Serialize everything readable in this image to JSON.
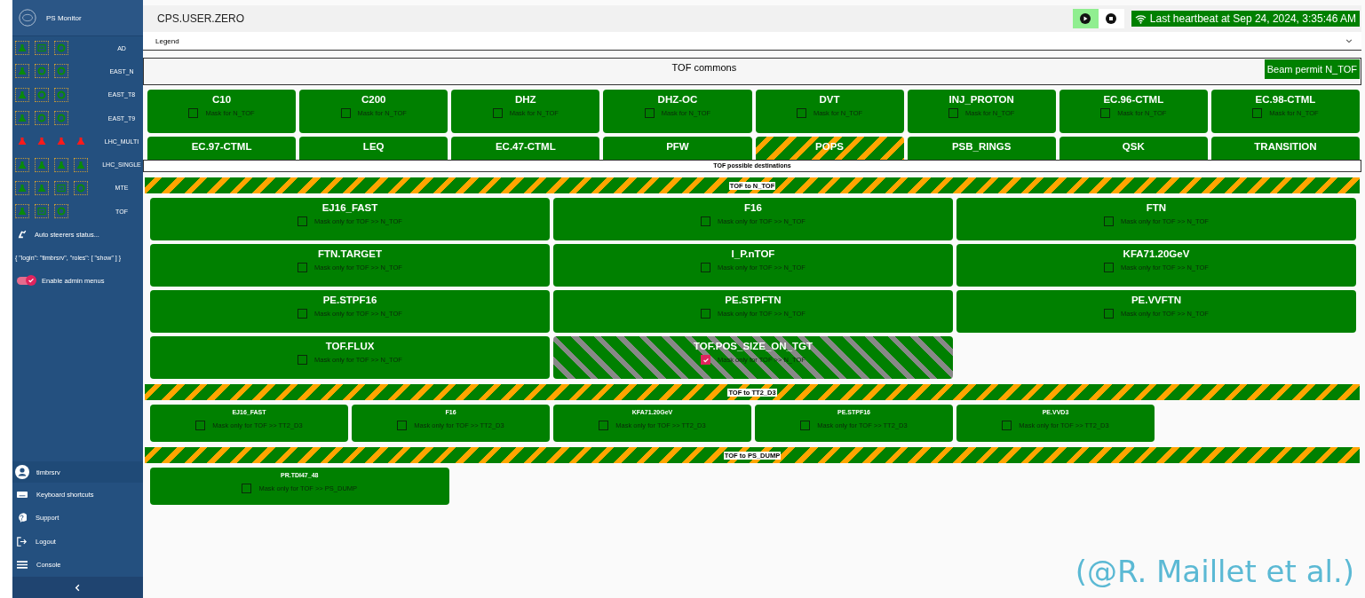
{
  "sidebar": {
    "app_title": "PS Monitor",
    "beams": [
      {
        "name": "AD",
        "icons": [
          {
            "kind": "flask",
            "alarm": false
          },
          {
            "kind": "door",
            "alarm": false
          },
          {
            "kind": "ring",
            "alarm": false
          }
        ]
      },
      {
        "name": "EAST_N",
        "icons": [
          {
            "kind": "flask",
            "alarm": false
          },
          {
            "kind": "ring",
            "alarm": false
          },
          {
            "kind": "ring",
            "alarm": false
          }
        ]
      },
      {
        "name": "EAST_T8",
        "icons": [
          {
            "kind": "flask",
            "alarm": false
          },
          {
            "kind": "ring",
            "alarm": false
          },
          {
            "kind": "ring",
            "alarm": false
          }
        ]
      },
      {
        "name": "EAST_T9",
        "icons": [
          {
            "kind": "flask",
            "alarm": false
          },
          {
            "kind": "ring",
            "alarm": false
          },
          {
            "kind": "ring",
            "alarm": false
          }
        ]
      },
      {
        "name": "LHC_MULTI",
        "icons": [
          {
            "kind": "flask",
            "alarm": true
          },
          {
            "kind": "flask",
            "alarm": true
          },
          {
            "kind": "flask",
            "alarm": true
          },
          {
            "kind": "flask",
            "alarm": true
          }
        ]
      },
      {
        "name": "LHC_SINGLE",
        "icons": [
          {
            "kind": "flask",
            "alarm": false
          },
          {
            "kind": "flask",
            "alarm": false
          },
          {
            "kind": "flask",
            "alarm": false
          },
          {
            "kind": "flask",
            "alarm": false
          }
        ]
      },
      {
        "name": "MTE",
        "icons": [
          {
            "kind": "flask",
            "alarm": false
          },
          {
            "kind": "flask",
            "alarm": false
          },
          {
            "kind": "door",
            "alarm": false
          },
          {
            "kind": "ring",
            "alarm": false
          }
        ]
      },
      {
        "name": "TOF",
        "icons": [
          {
            "kind": "flask",
            "alarm": false
          },
          {
            "kind": "door",
            "alarm": false
          },
          {
            "kind": "ring",
            "alarm": false
          }
        ]
      }
    ],
    "auto_steerers": "Auto steerers status...",
    "session_info": "{ \"login\": \"timbrsrv\", \"roles\": [ \"show\" ] }",
    "admin_toggle": {
      "label": "Enable admin menus",
      "on": true
    },
    "user": "timbrsrv",
    "menu": [
      {
        "kind": "keyboard",
        "label": "Keyboard shortcuts"
      },
      {
        "kind": "help",
        "label": "Support"
      },
      {
        "kind": "logout",
        "label": "Logout"
      },
      {
        "kind": "list",
        "label": "Console"
      }
    ]
  },
  "header": {
    "title": "CPS.USER.ZERO",
    "play_selected": true,
    "stop_selected": false,
    "heartbeat": "Last heartbeat at Sep 24, 2024, 3:35:46 AM"
  },
  "legend": {
    "label": "Legend",
    "expanded": false
  },
  "commons": {
    "title": "TOF commons",
    "beam_permit": "Beam permit N_TOF",
    "items": [
      {
        "name": "C10",
        "kind": "ok",
        "mask_label": "Mask for N_TOF",
        "checked": false
      },
      {
        "name": "C200",
        "kind": "ok",
        "mask_label": "Mask for N_TOF",
        "checked": false
      },
      {
        "name": "DHZ",
        "kind": "ok",
        "mask_label": "Mask for N_TOF",
        "checked": false
      },
      {
        "name": "DHZ-OC",
        "kind": "ok",
        "mask_label": "Mask for N_TOF",
        "checked": false
      },
      {
        "name": "DVT",
        "kind": "ok",
        "mask_label": "Mask for N_TOF",
        "checked": false
      },
      {
        "name": "INJ_PROTON",
        "kind": "ok",
        "mask_label": "Mask for N_TOF",
        "checked": false
      },
      {
        "name": "EC.96-CTML",
        "kind": "ok",
        "mask_label": "Mask for N_TOF",
        "checked": false
      },
      {
        "name": "EC.98-CTML",
        "kind": "ok",
        "mask_label": "Mask for N_TOF",
        "checked": false
      },
      {
        "name": "EC.97-CTML",
        "kind": "ok"
      },
      {
        "name": "LEQ",
        "kind": "ok"
      },
      {
        "name": "EC.47-CTML",
        "kind": "ok"
      },
      {
        "name": "PFW",
        "kind": "ok"
      },
      {
        "name": "POPS",
        "kind": "warning"
      },
      {
        "name": "PSB_RINGS",
        "kind": "ok"
      },
      {
        "name": "QSK",
        "kind": "ok"
      },
      {
        "name": "TRANSITION",
        "kind": "ok"
      }
    ]
  },
  "destinations_title": "TOF possible destinations",
  "destinations": [
    {
      "title": "TOF to N_TOF",
      "items": [
        {
          "name": "EJ16_FAST",
          "kind": "ok",
          "mask_label": "Mask only for TOF >> N_TOF",
          "checked": false
        },
        {
          "name": "F16",
          "kind": "ok",
          "mask_label": "Mask only for TOF >> N_TOF",
          "checked": false
        },
        {
          "name": "FTN",
          "kind": "ok",
          "mask_label": "Mask only for TOF >> N_TOF",
          "checked": false
        },
        {
          "name": "FTN.TARGET",
          "kind": "ok",
          "mask_label": "Mask only for TOF >> N_TOF",
          "checked": false
        },
        {
          "name": "I_P.nTOF",
          "kind": "ok",
          "mask_label": "Mask only for TOF >> N_TOF",
          "checked": false
        },
        {
          "name": "KFA71.20GeV",
          "kind": "ok",
          "mask_label": "Mask only for TOF >> N_TOF",
          "checked": false
        },
        {
          "name": "PE.STPF16",
          "kind": "ok",
          "mask_label": "Mask only for TOF >> N_TOF",
          "checked": false
        },
        {
          "name": "PE.STPFTN",
          "kind": "ok",
          "mask_label": "Mask only for TOF >> N_TOF",
          "checked": false
        },
        {
          "name": "PE.VVFTN",
          "kind": "ok",
          "mask_label": "Mask only for TOF >> N_TOF",
          "checked": false
        },
        {
          "name": "TOF.FLUX",
          "kind": "ok",
          "mask_label": "Mask only for TOF >> N_TOF",
          "checked": false
        },
        {
          "name": "TOF.POS_SIZE_ON_TGT",
          "kind": "masked",
          "mask_label": "Mask only for TOF >> N_TOF",
          "checked": true
        }
      ]
    },
    {
      "title": "TOF to TT2_D3",
      "items": [
        {
          "name": "EJ16_FAST",
          "kind": "ok",
          "mask_label": "Mask only for TOF >> TT2_D3",
          "checked": false
        },
        {
          "name": "F16",
          "kind": "ok",
          "mask_label": "Mask only for TOF >> TT2_D3",
          "checked": false
        },
        {
          "name": "KFA71.20GeV",
          "kind": "ok",
          "mask_label": "Mask only for TOF >> TT2_D3",
          "checked": false
        },
        {
          "name": "PE.STPF16",
          "kind": "ok",
          "mask_label": "Mask only for TOF >> TT2_D3",
          "checked": false
        },
        {
          "name": "PE.VVD3",
          "kind": "ok",
          "mask_label": "Mask only for TOF >> TT2_D3",
          "checked": false
        }
      ]
    },
    {
      "title": "TOF to PS_DUMP",
      "items": [
        {
          "name": "PR.TDI47_48",
          "kind": "ok",
          "mask_label": "Mask only for TOF >> PS_DUMP",
          "checked": false
        }
      ]
    }
  ],
  "caption": "(@R. Maillet et al.)"
}
